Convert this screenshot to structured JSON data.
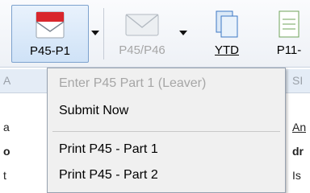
{
  "toolbar": {
    "items": [
      {
        "label": "P45-P1",
        "icon": "envelope-red-icon",
        "state": "active"
      },
      {
        "label": "P45/P46",
        "icon": "envelope-gray-icon",
        "state": "disabled"
      },
      {
        "label": "YTD",
        "icon": "documents-icon",
        "state": "normal"
      },
      {
        "label": "P11-",
        "icon": "spreadsheet-icon",
        "state": "normal"
      }
    ]
  },
  "menu": {
    "items": [
      {
        "label": "Enter P45 Part 1 (Leaver)",
        "enabled": false
      },
      {
        "label": "Submit Now",
        "enabled": true
      },
      {
        "label": "Print P45 - Part 1",
        "enabled": true
      },
      {
        "label": "Print P45 - Part 2",
        "enabled": true
      }
    ]
  },
  "background": {
    "fragments": [
      "A",
      "SI",
      "a",
      "An",
      "o",
      "dr",
      "t",
      "Is"
    ]
  },
  "colors": {
    "accent": "#7da2ce",
    "menu_bg": "#f0f0f0",
    "disabled_text": "#a6a6a6",
    "envelope_red": "#d9262c"
  }
}
